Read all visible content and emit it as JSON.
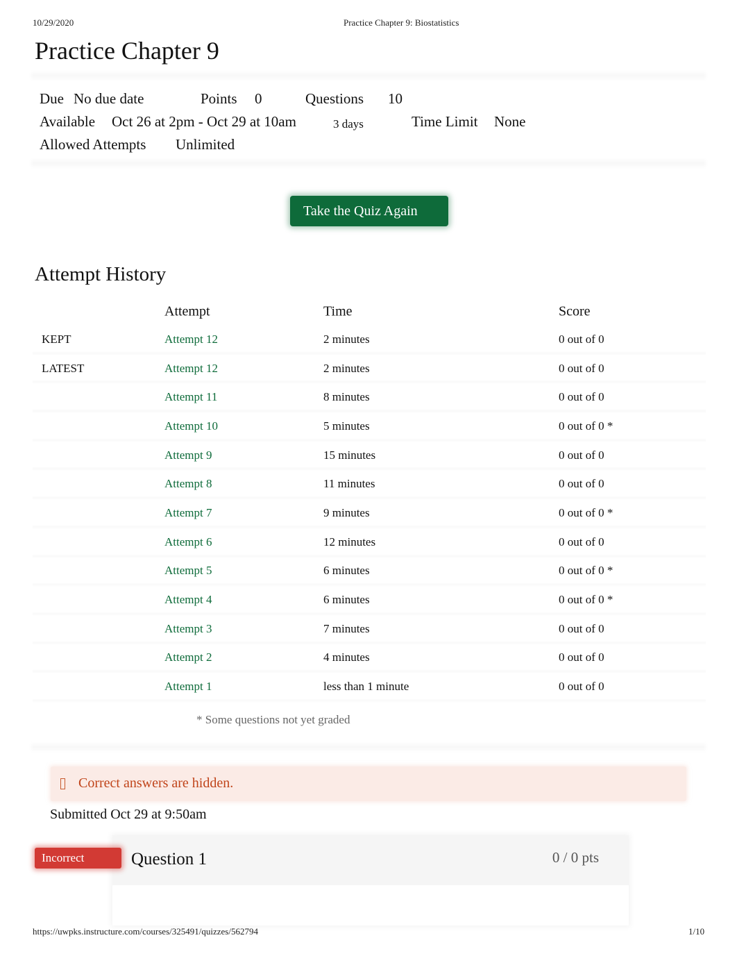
{
  "print_header": {
    "date": "10/29/2020",
    "title": "Practice Chapter 9: Biostatistics"
  },
  "page_title": "Practice Chapter 9",
  "details": {
    "due_label": "Due",
    "due_value": "No due date",
    "points_label": "Points",
    "points_value": "0",
    "questions_label": "Questions",
    "questions_value": "10",
    "available_label": "Available",
    "available_value": "Oct 26 at 2pm - Oct 29 at 10am",
    "available_duration": "3 days",
    "time_limit_label": "Time Limit",
    "time_limit_value": "None",
    "attempts_label": "Allowed Attempts",
    "attempts_value": "Unlimited"
  },
  "take_quiz_button": "Take the Quiz Again",
  "attempt_history": {
    "title": "Attempt History",
    "columns": [
      "",
      "Attempt",
      "Time",
      "Score"
    ],
    "rows": [
      {
        "tag": "KEPT",
        "attempt": "Attempt 12",
        "time": "2 minutes",
        "score": "0 out of 0"
      },
      {
        "tag": "LATEST",
        "attempt": "Attempt 12",
        "time": "2 minutes",
        "score": "0 out of 0"
      },
      {
        "tag": "",
        "attempt": "Attempt 11",
        "time": "8 minutes",
        "score": "0 out of 0"
      },
      {
        "tag": "",
        "attempt": "Attempt 10",
        "time": "5 minutes",
        "score": "0 out of 0 *"
      },
      {
        "tag": "",
        "attempt": "Attempt 9",
        "time": "15 minutes",
        "score": "0 out of 0"
      },
      {
        "tag": "",
        "attempt": "Attempt 8",
        "time": "11 minutes",
        "score": "0 out of 0"
      },
      {
        "tag": "",
        "attempt": "Attempt 7",
        "time": "9 minutes",
        "score": "0 out of 0 *"
      },
      {
        "tag": "",
        "attempt": "Attempt 6",
        "time": "12 minutes",
        "score": "0 out of 0"
      },
      {
        "tag": "",
        "attempt": "Attempt 5",
        "time": "6 minutes",
        "score": "0 out of 0 *"
      },
      {
        "tag": "",
        "attempt": "Attempt 4",
        "time": "6 minutes",
        "score": "0 out of 0 *"
      },
      {
        "tag": "",
        "attempt": "Attempt 3",
        "time": "7 minutes",
        "score": "0 out of 0"
      },
      {
        "tag": "",
        "attempt": "Attempt 2",
        "time": "4 minutes",
        "score": "0 out of 0"
      },
      {
        "tag": "",
        "attempt": "Attempt 1",
        "time": "less than 1 minute",
        "score": "0 out of 0"
      }
    ],
    "note": "* Some questions not yet graded"
  },
  "alert": {
    "icon": "warning-icon",
    "message": "Correct answers are hidden."
  },
  "submitted": "Submitted Oct 29 at 9:50am",
  "question": {
    "status": "Incorrect",
    "title": "Question 1",
    "points": "0 / 0 pts"
  },
  "print_footer": {
    "url": "https://uwpks.instructure.com/courses/325491/quizzes/562794",
    "page": "1/10"
  },
  "colors": {
    "brand_green": "#0e6b3a",
    "incorrect_red": "#d23a34",
    "alert_text": "#c0441a",
    "alert_bg": "#fbebe6"
  }
}
